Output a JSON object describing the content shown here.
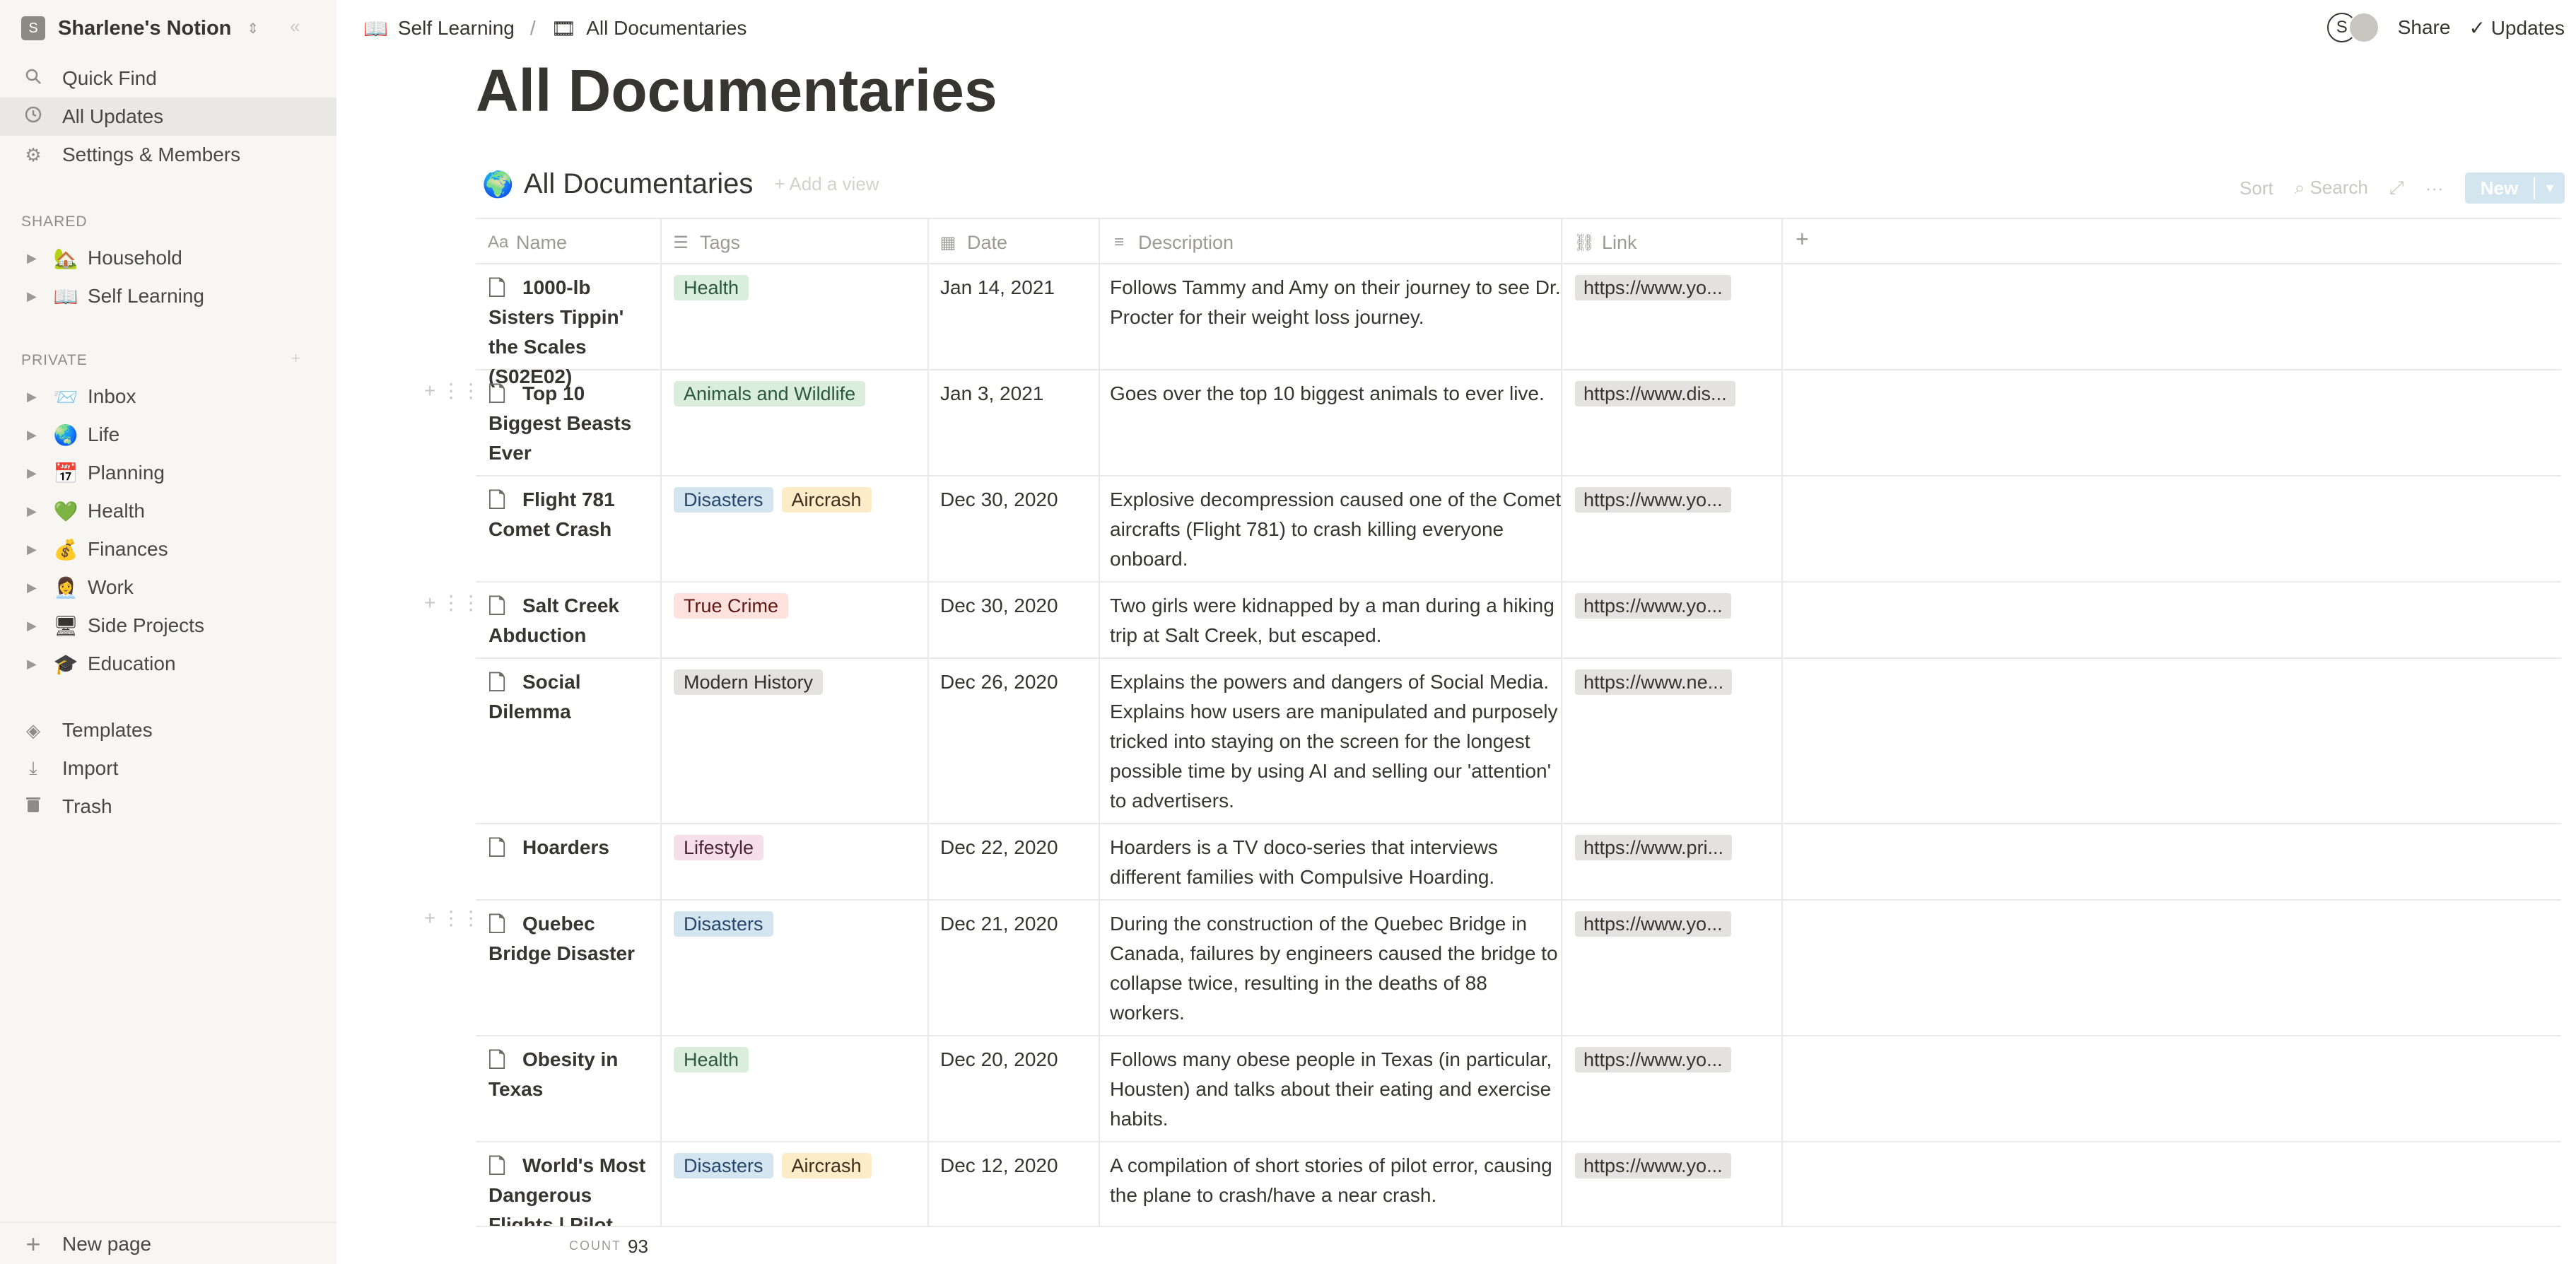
{
  "workspace": {
    "badge": "S",
    "name": "Sharlene's Notion"
  },
  "sidebar": {
    "nav": [
      {
        "label": "Quick Find",
        "icon": "search-icon"
      },
      {
        "label": "All Updates",
        "icon": "clock-icon"
      },
      {
        "label": "Settings & Members",
        "icon": "gear-icon"
      }
    ],
    "shared_label": "SHARED",
    "shared": [
      {
        "label": "Household",
        "emoji": "🏡"
      },
      {
        "label": "Self Learning",
        "emoji": "📖"
      }
    ],
    "private_label": "PRIVATE",
    "private": [
      {
        "label": "Inbox",
        "emoji": "📨"
      },
      {
        "label": "Life",
        "emoji": "🌏"
      },
      {
        "label": "Planning",
        "emoji": "📅"
      },
      {
        "label": "Health",
        "emoji": "💚"
      },
      {
        "label": "Finances",
        "emoji": "💰"
      },
      {
        "label": "Work",
        "emoji": "👩‍💼"
      },
      {
        "label": "Side Projects",
        "emoji": "🖥"
      },
      {
        "label": "Education",
        "emoji": "🎓"
      }
    ],
    "bottom": [
      {
        "label": "Templates",
        "icon": "shapes-icon"
      },
      {
        "label": "Import",
        "icon": "download-icon"
      },
      {
        "label": "Trash",
        "icon": "trash-icon"
      }
    ],
    "new_page": "New page"
  },
  "breadcrumb": {
    "parent": "Self Learning",
    "parent_emoji": "📖",
    "current": "All Documentaries",
    "current_emoji": "🎞",
    "separator": "/"
  },
  "topbar": {
    "avatar_initial": "S",
    "share": "Share",
    "updates": "Updates",
    "updates_check": "✓"
  },
  "page": {
    "title": "All Documentaries"
  },
  "database": {
    "name": "All Documentaries",
    "emoji": "🌍",
    "add_view": "Add a view",
    "sort": "Sort",
    "search": "Search",
    "new": "New"
  },
  "columns": {
    "name": "Name",
    "tags": "Tags",
    "date": "Date",
    "description": "Description",
    "link": "Link"
  },
  "rows": [
    {
      "name": "1000-lb Sisters Tippin' the Scales (S02E02)",
      "tags": [
        {
          "text": "Health",
          "color": "green"
        }
      ],
      "date": "Jan 14, 2021",
      "description": "Follows Tammy and Amy on their journey to see Dr. Procter for their weight loss journey.",
      "link": "https://www.yo..."
    },
    {
      "name": "Top 10 Biggest Beasts Ever",
      "tags": [
        {
          "text": "Animals and Wildlife",
          "color": "green"
        }
      ],
      "date": "Jan 3, 2021",
      "description": "Goes over the top 10 biggest animals to ever live.",
      "link": "https://www.dis..."
    },
    {
      "name": "Flight 781 Comet Crash",
      "tags": [
        {
          "text": "Disasters",
          "color": "blue"
        },
        {
          "text": "Aircrash",
          "color": "yellow"
        }
      ],
      "date": "Dec 30, 2020",
      "description": "Explosive decompression caused one of the Comet aircrafts (Flight 781) to crash killing everyone onboard.",
      "link": "https://www.yo..."
    },
    {
      "name": "Salt Creek Abduction",
      "tags": [
        {
          "text": "True Crime",
          "color": "red"
        }
      ],
      "date": "Dec 30, 2020",
      "description": "Two girls were kidnapped by a man during a hiking trip at Salt Creek, but escaped.",
      "link": "https://www.yo..."
    },
    {
      "name": "Social Dilemma",
      "tags": [
        {
          "text": "Modern History",
          "color": "gray"
        }
      ],
      "date": "Dec 26, 2020",
      "description": "Explains the powers and dangers of Social Media. Explains how users are manipulated and purposely tricked into staying on the screen for the longest possible time by using AI and selling our 'attention' to advertisers.",
      "link": "https://www.ne..."
    },
    {
      "name": "Hoarders",
      "tags": [
        {
          "text": "Lifestyle",
          "color": "pink"
        }
      ],
      "date": "Dec 22, 2020",
      "description": "Hoarders is a TV doco-series that interviews different families with Compulsive Hoarding.",
      "link": "https://www.pri..."
    },
    {
      "name": "Quebec Bridge Disaster",
      "tags": [
        {
          "text": "Disasters",
          "color": "blue"
        }
      ],
      "date": "Dec 21, 2020",
      "description": "During the construction of the Quebec Bridge in Canada, failures by engineers caused the bridge to collapse twice, resulting in the deaths of 88 workers.",
      "link": "https://www.yo..."
    },
    {
      "name": "Obesity in Texas",
      "tags": [
        {
          "text": "Health",
          "color": "green"
        }
      ],
      "date": "Dec 20, 2020",
      "description": "Follows many obese people in Texas (in particular, Housten) and talks about their eating and exercise habits.",
      "link": "https://www.yo..."
    },
    {
      "name": "World's Most Dangerous Flights | Pilot",
      "tags": [
        {
          "text": "Disasters",
          "color": "blue"
        },
        {
          "text": "Aircrash",
          "color": "yellow"
        }
      ],
      "date": "Dec 12, 2020",
      "description": "A compilation of short stories of pilot error, causing the plane to crash/have a near crash.",
      "link": "https://www.yo..."
    }
  ],
  "footer": {
    "count_label": "COUNT",
    "count_value": "93"
  }
}
